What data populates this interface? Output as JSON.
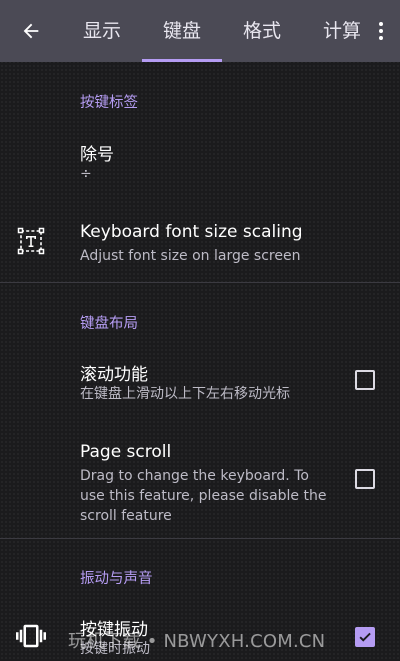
{
  "toolbar": {
    "back_icon": "arrow-left-icon",
    "tabs": [
      {
        "label": "显示"
      },
      {
        "label": "键盘"
      },
      {
        "label": "格式"
      },
      {
        "label": "计算"
      }
    ],
    "selected_tab": "键盘",
    "overflow_icon": "more-vertical-icon"
  },
  "sections": {
    "labels": {
      "header": "按键标签",
      "division": {
        "title": "除号",
        "summary": "÷"
      },
      "font_scaling": {
        "icon": "text-fields-icon",
        "title": "Keyboard font size scaling",
        "summary": "Adjust font size on large screen"
      }
    },
    "layout": {
      "header": "键盘布局",
      "scroll_function": {
        "title": "滚动功能",
        "summary": "在键盘上滑动以上下左右移动光标",
        "checked": false
      },
      "page_scroll": {
        "title": "Page scroll",
        "summary": "Drag to change the keyboard. To use this feature, please disable the scroll feature",
        "checked": false
      }
    },
    "feedback": {
      "header": "振动与声音",
      "key_vibration": {
        "icon": "vibration-icon",
        "title": "按键振动",
        "summary": "按键时振动",
        "checked": true
      }
    }
  },
  "watermark": "玩机下载 • NBWYXH.COM.CN",
  "colors": {
    "accent": "#b59cf3",
    "toolbar": "#4b4a55",
    "background": "#1b1b1d"
  }
}
